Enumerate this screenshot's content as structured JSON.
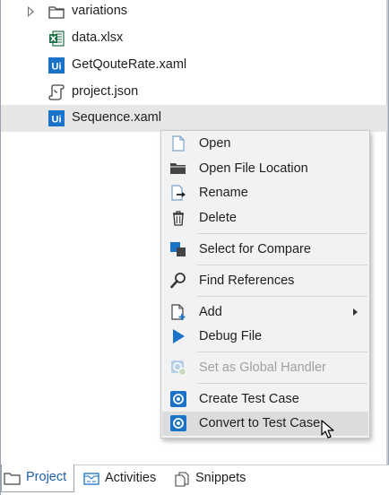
{
  "tree": {
    "items": [
      {
        "label": "variations",
        "icon": "folder-icon"
      },
      {
        "label": "data.xlsx",
        "icon": "excel-icon"
      },
      {
        "label": "GetQouteRate.xaml",
        "icon": "uipath-xaml-icon"
      },
      {
        "label": "project.json",
        "icon": "json-scroll-icon"
      },
      {
        "label": "Sequence.xaml",
        "icon": "uipath-xaml-icon",
        "selected": true
      }
    ]
  },
  "context_menu": {
    "items": [
      {
        "label": "Open",
        "icon": "document-icon"
      },
      {
        "label": "Open File Location",
        "icon": "folder-open-icon"
      },
      {
        "label": "Rename",
        "icon": "rename-icon"
      },
      {
        "label": "Delete",
        "icon": "trash-icon"
      },
      {
        "label": "Select for Compare",
        "icon": "compare-icon"
      },
      {
        "label": "Find References",
        "icon": "magnifier-icon"
      },
      {
        "label": "Add",
        "icon": "add-file-icon",
        "submenu": true
      },
      {
        "label": "Debug File",
        "icon": "play-icon"
      },
      {
        "label": "Set as Global Handler",
        "icon": "global-handler-icon",
        "disabled": true
      },
      {
        "label": "Create Test Case",
        "icon": "test-case-icon"
      },
      {
        "label": "Convert to Test Case",
        "icon": "test-case-icon",
        "hovered": true
      }
    ]
  },
  "bottom_tabs": [
    {
      "label": "Project",
      "icon": "project-folder-icon",
      "active": true
    },
    {
      "label": "Activities",
      "icon": "activities-icon"
    },
    {
      "label": "Snippets",
      "icon": "snippets-icon"
    }
  ],
  "colors": {
    "accent_blue": "#1f5fa6",
    "uipath_blue": "#1a73c8",
    "excel_green": "#1e7145",
    "selection": "#e6e6e6",
    "menu_bg": "#f2f2f2",
    "menu_hover": "#dcdcdc"
  }
}
